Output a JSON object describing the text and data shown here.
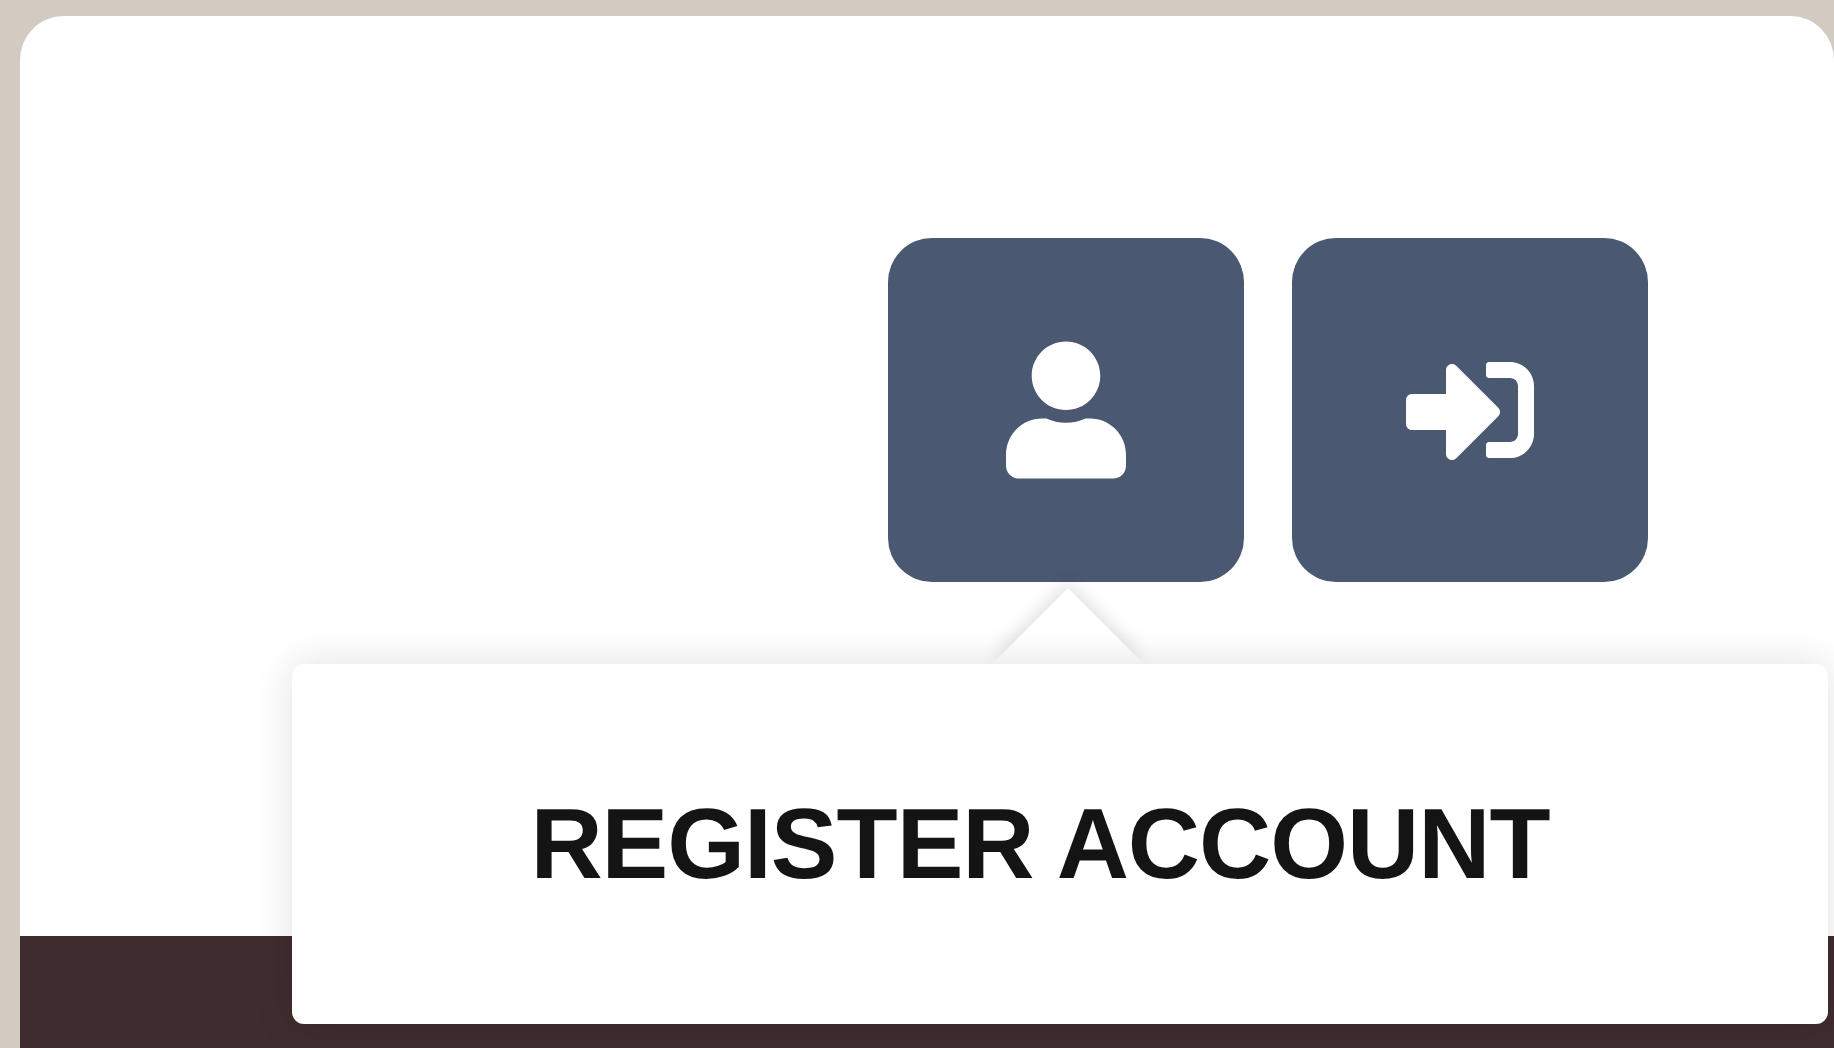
{
  "buttons": [
    {
      "kind": "user"
    },
    {
      "kind": "login"
    }
  ],
  "tooltip": {
    "text": "REGISTER ACCOUNT"
  }
}
